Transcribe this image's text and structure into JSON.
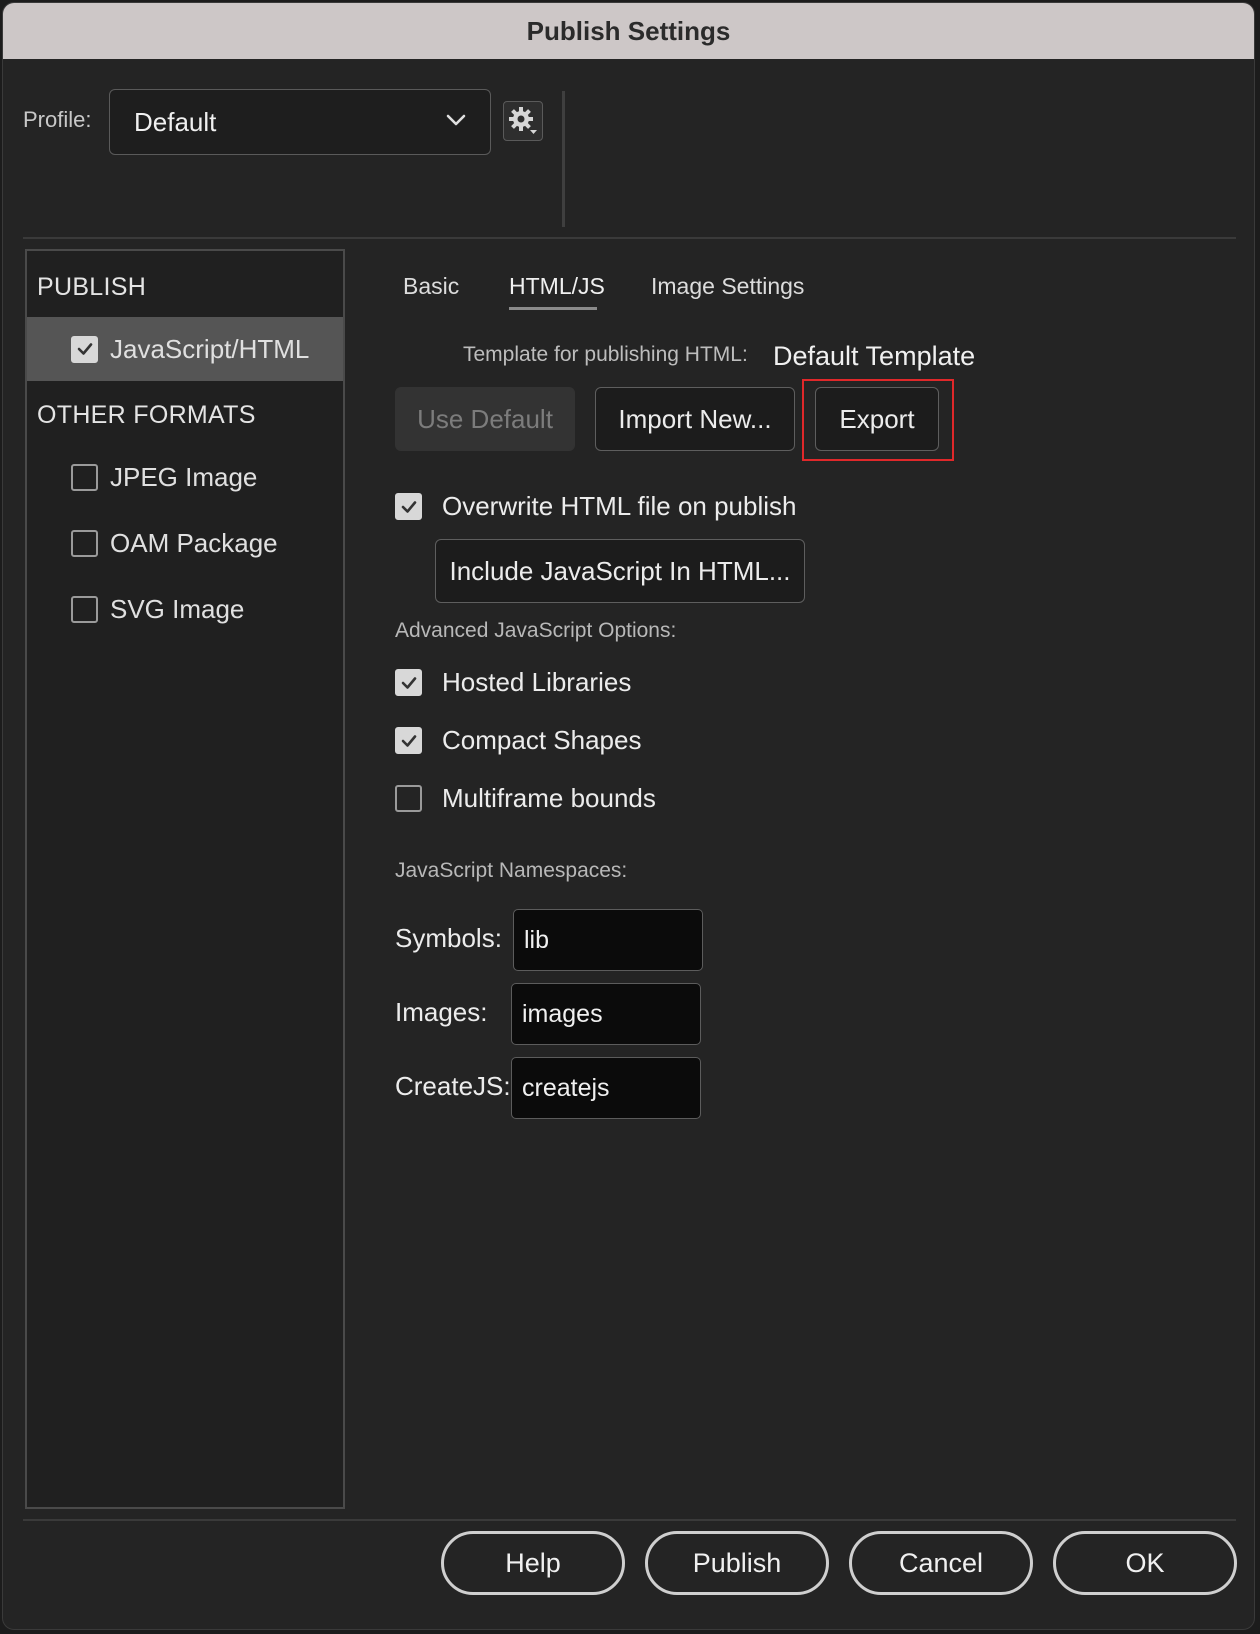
{
  "window": {
    "title": "Publish Settings"
  },
  "profile": {
    "label": "Profile:",
    "value": "Default"
  },
  "sidebar": {
    "publish_heading": "PUBLISH",
    "publish_items": [
      {
        "label": "JavaScript/HTML",
        "checked": true
      }
    ],
    "other_heading": "OTHER FORMATS",
    "other_items": [
      {
        "label": "JPEG Image",
        "checked": false
      },
      {
        "label": "OAM Package",
        "checked": false
      },
      {
        "label": "SVG Image",
        "checked": false
      }
    ]
  },
  "tabs": [
    {
      "label": "Basic"
    },
    {
      "label": "HTML/JS",
      "active": true
    },
    {
      "label": "Image Settings"
    }
  ],
  "template": {
    "label": "Template for publishing HTML:",
    "value": "Default Template",
    "use_default": "Use Default",
    "import_new": "Import New...",
    "export": "Export"
  },
  "overwrite": {
    "label": "Overwrite HTML file on publish",
    "checked": true
  },
  "include_js_button": "Include JavaScript In HTML...",
  "advanced": {
    "heading": "Advanced JavaScript Options:",
    "options": [
      {
        "label": "Hosted Libraries",
        "checked": true
      },
      {
        "label": "Compact Shapes",
        "checked": true
      },
      {
        "label": "Multiframe bounds",
        "checked": false
      }
    ]
  },
  "namespaces": {
    "heading": "JavaScript Namespaces:",
    "fields": [
      {
        "label": "Symbols:",
        "value": "lib"
      },
      {
        "label": "Images:",
        "value": "images"
      },
      {
        "label": "CreateJS:",
        "value": "createjs"
      }
    ]
  },
  "footer": {
    "help": "Help",
    "publish": "Publish",
    "cancel": "Cancel",
    "ok": "OK"
  },
  "colors": {
    "highlight": "#e0282a",
    "titlebar": "#cdc7c7",
    "active_item": "#555555"
  }
}
